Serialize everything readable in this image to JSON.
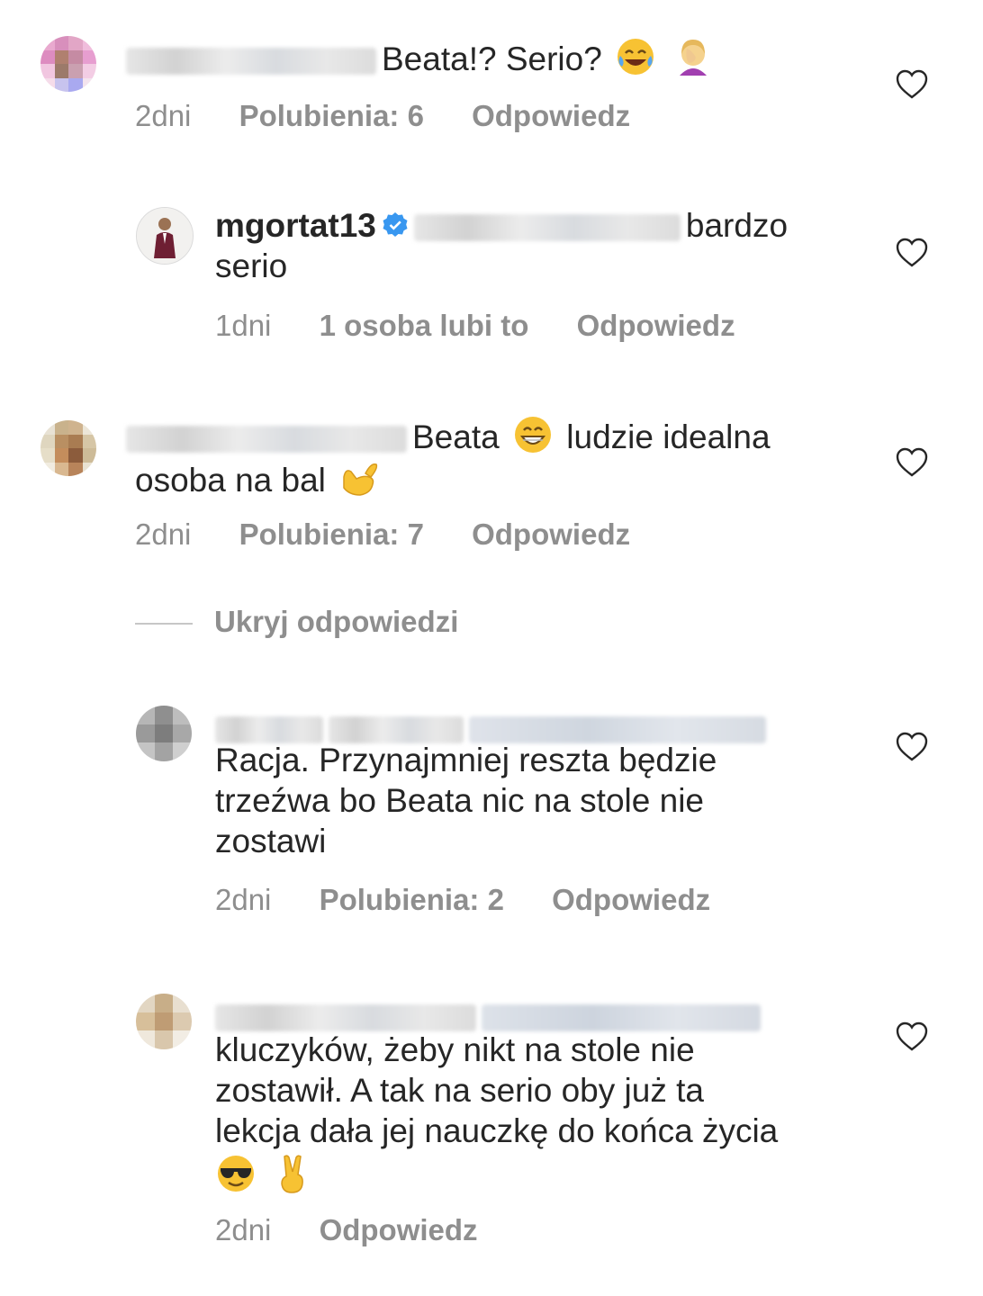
{
  "comments": [
    {
      "text": "Beata!? Serio?",
      "time": "2dni",
      "likes": "Polubienia: 6",
      "reply": "Odpowiedz"
    },
    {
      "username": "mgortat13",
      "text_line1": "bardzo",
      "text_line2": "serio",
      "time": "1dni",
      "likes": "1 osoba lubi to",
      "reply": "Odpowiedz"
    },
    {
      "text_line1": "Beata",
      "text_line1b": "ludzie idealna",
      "text_line2": "osoba na bal",
      "time": "2dni",
      "likes": "Polubienia: 7",
      "reply": "Odpowiedz"
    },
    {
      "text_line1": "Racja. Przynajmniej reszta będzie",
      "text_line2": "trzeźwa bo Beata nic na stole nie",
      "text_line3": "zostawi",
      "time": "2dni",
      "likes": "Polubienia: 2",
      "reply": "Odpowiedz"
    },
    {
      "text_line1": "kluczyków, żeby nikt na stole nie",
      "text_line2": "zostawił. A tak na serio oby już ta",
      "text_line3": "lekcja dała jej nauczkę do końca życia",
      "time": "2dni",
      "reply": "Odpowiedz"
    }
  ],
  "hide_replies": "Ukryj odpowiedzi",
  "colors": {
    "text": "#262626",
    "meta": "#8e8e8e",
    "verified": "#3897f0",
    "heart_stroke": "#262626"
  },
  "icons": [
    "heart-icon",
    "verified-badge-icon",
    "tears-of-joy-emoji",
    "facepalm-emoji",
    "grin-emoji",
    "call-me-hand-emoji",
    "sunglasses-emoji",
    "victory-hand-emoji"
  ]
}
